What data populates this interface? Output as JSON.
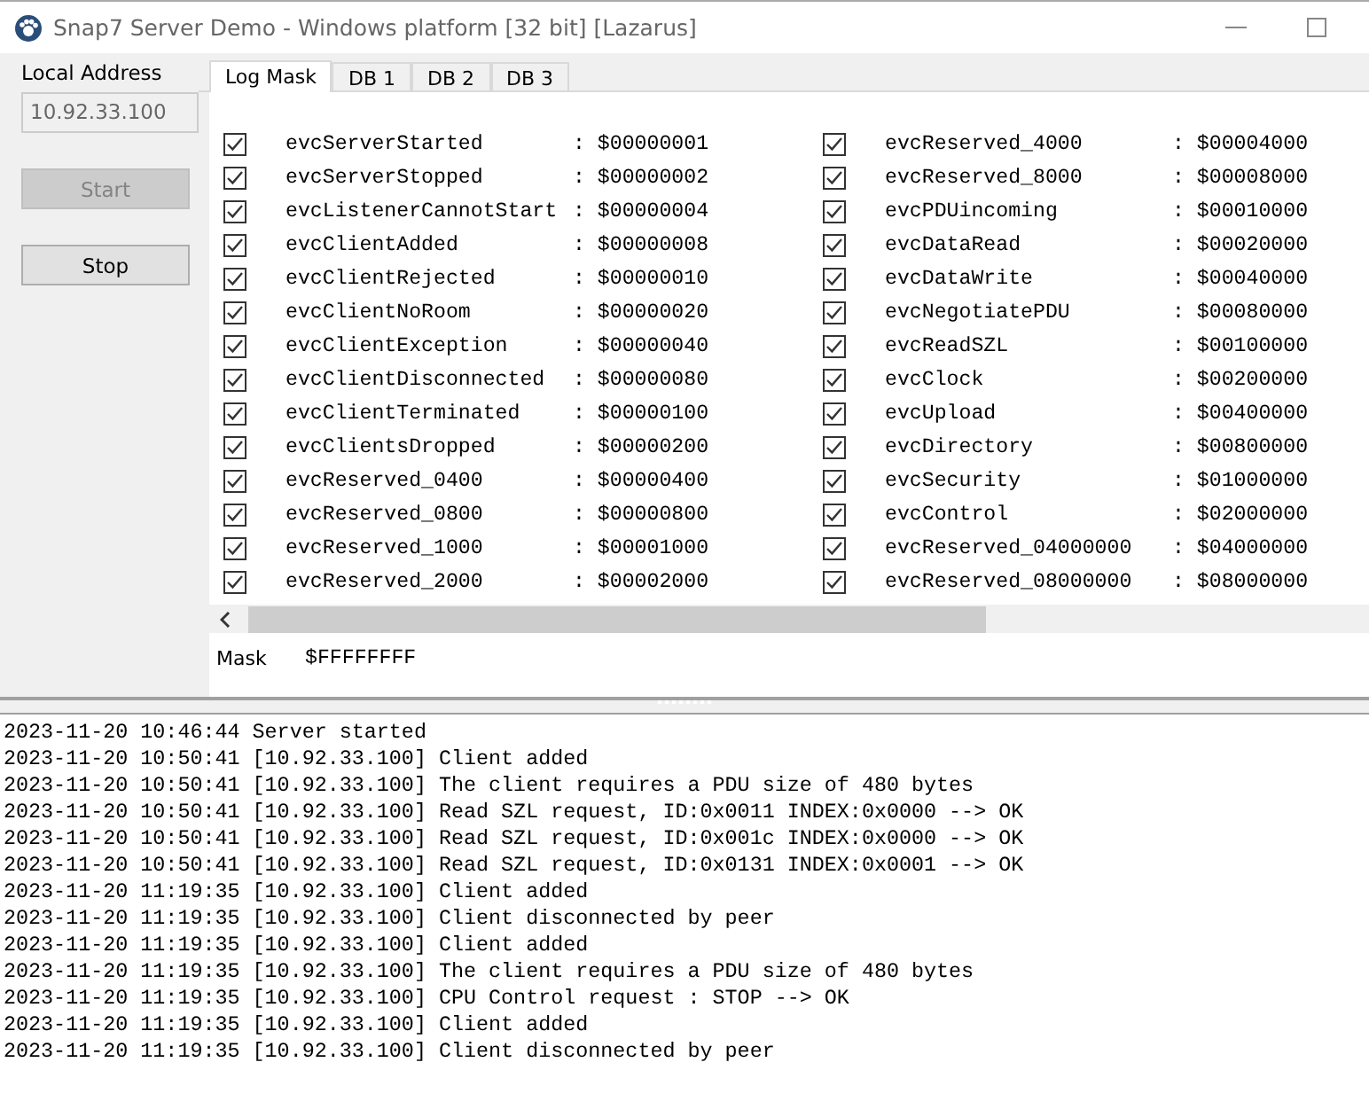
{
  "window": {
    "title": "Snap7 Server Demo - Windows platform [32 bit] [Lazarus]"
  },
  "left_panel": {
    "address_label": "Local Address",
    "address": "10.92.33.100",
    "buttons": [
      {
        "label": "Start",
        "disabled": true
      },
      {
        "label": "Stop",
        "disabled": false
      }
    ]
  },
  "tabs": [
    {
      "label": "Log Mask",
      "selected": true
    },
    {
      "label": "DB 1",
      "selected": false
    },
    {
      "label": "DB 2",
      "selected": false
    },
    {
      "label": "DB 3",
      "selected": false
    }
  ],
  "flag_columns": [
    [
      {
        "name": "evcServerStarted",
        "value": ": $00000001",
        "checked": true
      },
      {
        "name": "evcServerStopped",
        "value": ": $00000002",
        "checked": true
      },
      {
        "name": "evcListenerCannotStart",
        "value": ": $00000004",
        "checked": true
      },
      {
        "name": "evcClientAdded",
        "value": ": $00000008",
        "checked": true
      },
      {
        "name": "evcClientRejected",
        "value": ": $00000010",
        "checked": true
      },
      {
        "name": "evcClientNoRoom",
        "value": ": $00000020",
        "checked": true
      },
      {
        "name": "evcClientException",
        "value": ": $00000040",
        "checked": true
      },
      {
        "name": "evcClientDisconnected",
        "value": ": $00000080",
        "checked": true
      },
      {
        "name": "evcClientTerminated",
        "value": ": $00000100",
        "checked": true
      },
      {
        "name": "evcClientsDropped",
        "value": ": $00000200",
        "checked": true
      },
      {
        "name": "evcReserved_0400",
        "value": ": $00000400",
        "checked": true
      },
      {
        "name": "evcReserved_0800",
        "value": ": $00000800",
        "checked": true
      },
      {
        "name": "evcReserved_1000",
        "value": ": $00001000",
        "checked": true
      },
      {
        "name": "evcReserved_2000",
        "value": ": $00002000",
        "checked": true
      }
    ],
    [
      {
        "name": "evcReserved_4000",
        "value": ": $00004000",
        "checked": true
      },
      {
        "name": "evcReserved_8000",
        "value": ": $00008000",
        "checked": true
      },
      {
        "name": "evcPDUincoming",
        "value": ": $00010000",
        "checked": true
      },
      {
        "name": "evcDataRead",
        "value": ": $00020000",
        "checked": true
      },
      {
        "name": "evcDataWrite",
        "value": ": $00040000",
        "checked": true
      },
      {
        "name": "evcNegotiatePDU",
        "value": ": $00080000",
        "checked": true
      },
      {
        "name": "evcReadSZL",
        "value": ": $00100000",
        "checked": true
      },
      {
        "name": "evcClock",
        "value": ": $00200000",
        "checked": true
      },
      {
        "name": "evcUpload",
        "value": ": $00400000",
        "checked": true
      },
      {
        "name": "evcDirectory",
        "value": ": $00800000",
        "checked": true
      },
      {
        "name": "evcSecurity",
        "value": ": $01000000",
        "checked": true
      },
      {
        "name": "evcControl",
        "value": ": $02000000",
        "checked": true
      },
      {
        "name": "evcReserved_04000000",
        "value": ": $04000000",
        "checked": true
      },
      {
        "name": "evcReserved_08000000",
        "value": ": $08000000",
        "checked": true
      }
    ]
  ],
  "mask": {
    "label": "Mask",
    "value": "$FFFFFFFF"
  },
  "log": [
    "2023-11-20 10:46:44 Server started",
    "2023-11-20 10:50:41 [10.92.33.100] Client added",
    "2023-11-20 10:50:41 [10.92.33.100] The client requires a PDU size of 480 bytes",
    "2023-11-20 10:50:41 [10.92.33.100] Read SZL request, ID:0x0011 INDEX:0x0000 --> OK",
    "2023-11-20 10:50:41 [10.92.33.100] Read SZL request, ID:0x001c INDEX:0x0000 --> OK",
    "2023-11-20 10:50:41 [10.92.33.100] Read SZL request, ID:0x0131 INDEX:0x0001 --> OK",
    "2023-11-20 11:19:35 [10.92.33.100] Client added",
    "2023-11-20 11:19:35 [10.92.33.100] Client disconnected by peer",
    "2023-11-20 11:19:35 [10.92.33.100] Client added",
    "2023-11-20 11:19:35 [10.92.33.100] The client requires a PDU size of 480 bytes",
    "2023-11-20 11:19:35 [10.92.33.100] CPU Control request : STOP --> OK",
    "2023-11-20 11:19:35 [10.92.33.100] Client added",
    "2023-11-20 11:19:35 [10.92.33.100] Client disconnected by peer"
  ]
}
